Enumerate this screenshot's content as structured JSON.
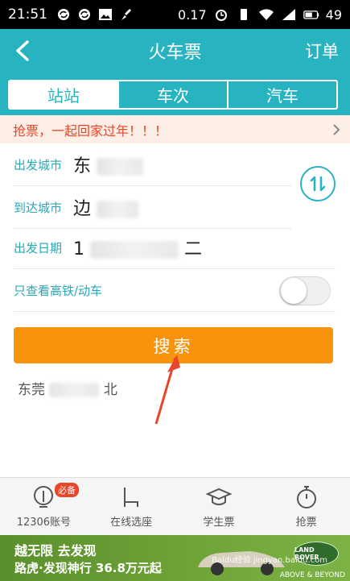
{
  "statusbar": {
    "time": "21:51",
    "data_rate": "0.17",
    "battery": "49"
  },
  "header": {
    "title": "火车票",
    "orders": "订单"
  },
  "tabs": [
    {
      "label": "站站"
    },
    {
      "label": "车次"
    },
    {
      "label": "汽车"
    }
  ],
  "promo": {
    "text": "抢票，一起回家过年！！！"
  },
  "form": {
    "from_label": "出发城市",
    "from_value": "东",
    "to_label": "到达城市",
    "to_value": "边",
    "date_label": "出发日期",
    "date_value": "1",
    "date_suffix": "二",
    "highspeed_label": "只查看高铁/动车"
  },
  "search": {
    "label": "搜索"
  },
  "history": {
    "text_start": "东莞",
    "text_end": "北"
  },
  "bottomnav": {
    "items": [
      {
        "label": "12306账号",
        "icon": "account-icon",
        "badge": "必备"
      },
      {
        "label": "在线选座",
        "icon": "seat-icon"
      },
      {
        "label": "学生票",
        "icon": "student-icon"
      },
      {
        "label": "抢票",
        "icon": "stopwatch-icon"
      }
    ]
  },
  "ad": {
    "line1": "越无限 去发现",
    "line2": "路虎·发现神行 36.8万元起",
    "brand": "LAND ROVER",
    "tagline": "ABOVE & BEYOND",
    "watermark": "Baidu经验 jingyan.baidu.com"
  },
  "colors": {
    "accent": "#28b3c0",
    "promo_text": "#e8452b",
    "search_button": "#f8930e"
  }
}
